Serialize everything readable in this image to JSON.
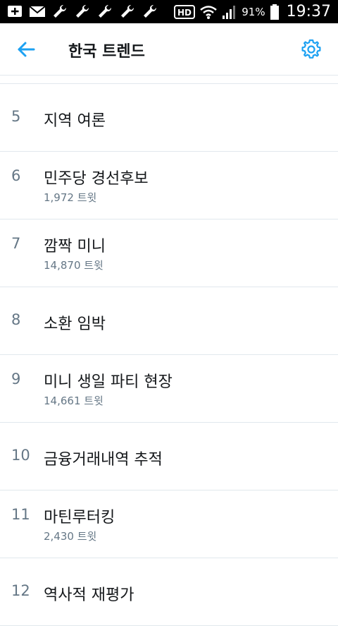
{
  "status_bar": {
    "battery_percent": "91%",
    "time": "19:37",
    "hd_label": "HD"
  },
  "header": {
    "title": "한국 트렌드"
  },
  "trends": [
    {
      "rank": "5",
      "name": "지역 여론",
      "count": ""
    },
    {
      "rank": "6",
      "name": "민주당 경선후보",
      "count": "1,972 트윗"
    },
    {
      "rank": "7",
      "name": "깜짝 미니",
      "count": "14,870 트윗"
    },
    {
      "rank": "8",
      "name": "소환 임박",
      "count": ""
    },
    {
      "rank": "9",
      "name": "미니 생일 파티 현장",
      "count": "14,661 트윗"
    },
    {
      "rank": "10",
      "name": "금융거래내역 추적",
      "count": ""
    },
    {
      "rank": "11",
      "name": "마틴루터킹",
      "count": "2,430 트윗"
    },
    {
      "rank": "12",
      "name": "역사적 재평가",
      "count": ""
    }
  ],
  "colors": {
    "accent": "#1da1f2",
    "text_primary": "#14171a",
    "text_secondary": "#657786",
    "divider": "#e1e8ed"
  }
}
